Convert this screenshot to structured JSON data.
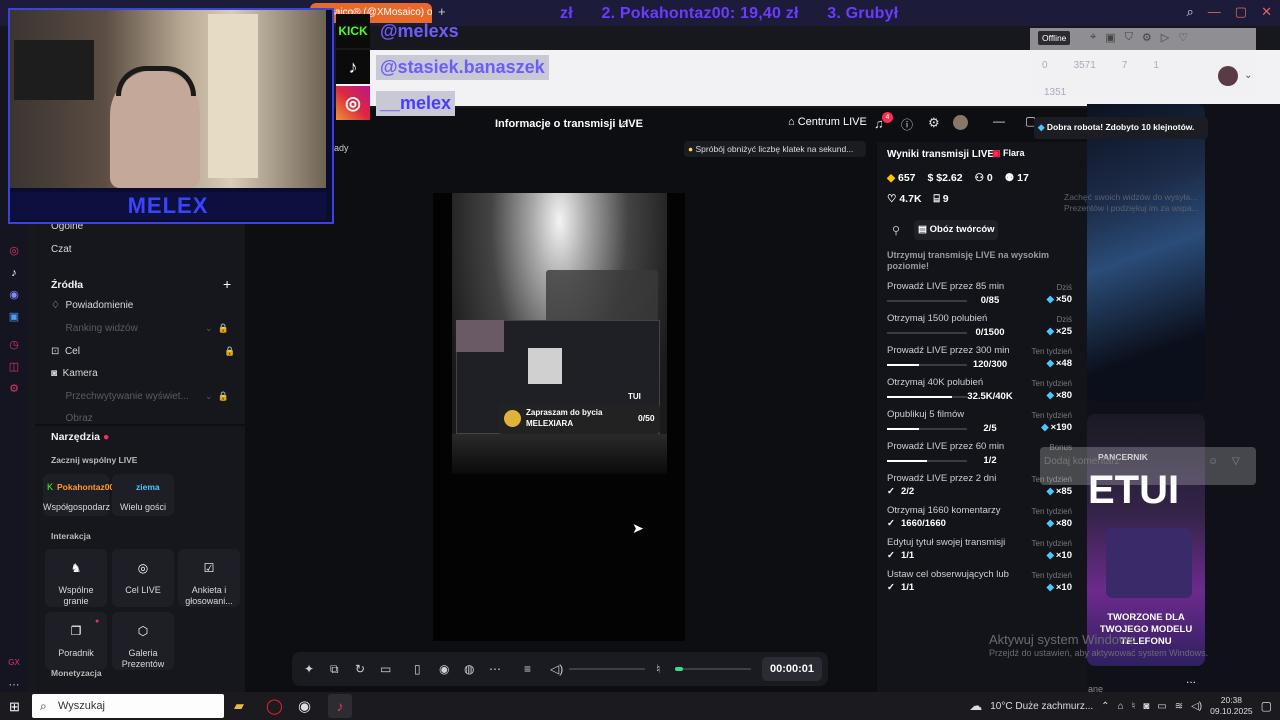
{
  "browser": {
    "active_tab": "Mosaico® (@XMosaico) o",
    "ticker": [
      "zł",
      "2. Pokahontaz00: 19,40 zł",
      "3. Grubył"
    ],
    "offline_badge": "Offline",
    "stats_faded": [
      "0",
      "3571",
      "7",
      "1"
    ],
    "stats_faded2": "1351"
  },
  "overlay": {
    "streamer_name": "MELEX",
    "kick_handle": "@melexs",
    "tiktok_handle": "@stasiek.banaszek",
    "instagram_handle": "__melex",
    "kick_label": "KICK"
  },
  "studio": {
    "title": "Informacje o transmisji LIVE",
    "center_button": "Centrum LIVE",
    "notification_count": "4",
    "hint": "Spróbój obniżyć liczbę klatek na sekund...",
    "left_fragment": "ady",
    "timer": "00:00:01",
    "sidebar": {
      "items_top": [
        "Ogólne",
        "Czat"
      ],
      "sources_heading": "Źródła",
      "sources": [
        {
          "label": "Powiadomienie",
          "dim": false
        },
        {
          "label": "Ranking widzów",
          "dim": true
        },
        {
          "label": "Cel",
          "dim": false
        },
        {
          "label": "Kamera",
          "dim": false
        },
        {
          "label": "Przechwytywanie wyświet...",
          "dim": true
        },
        {
          "label": "Obraz",
          "dim": true
        }
      ],
      "tools_heading": "Narzędzia",
      "start_joint": "Zacznij wspólny LIVE",
      "cohost_overlay_1": "Pokahontaz00",
      "cohost_overlay_2": "ziema",
      "cohost": [
        "Współgospodarz",
        "Wielu gości"
      ],
      "interaction_heading": "Interakcja",
      "interaction": [
        "Wspólne granie",
        "Cel LIVE",
        "Ankieta i głosowani...",
        "Poradnik",
        "Galeria Prezentów"
      ],
      "monetization_heading": "Monetyzacja"
    },
    "preview": {
      "card_text": "Zapraszam do bycia MELEXIARA",
      "card_count": "0/50",
      "overlay_text": "TUI"
    },
    "results": {
      "heading": "Wyniki transmisji LIVE",
      "badge": "Flara",
      "stats": [
        {
          "icon": "gem-icon",
          "value": "657"
        },
        {
          "icon": "dollar-icon",
          "value": "$2.62"
        },
        {
          "icon": "users-icon",
          "value": "0"
        },
        {
          "icon": "user-plus-icon",
          "value": "17"
        },
        {
          "icon": "heart-icon",
          "value": "4.7K"
        },
        {
          "icon": "gift-icon",
          "value": "9"
        }
      ],
      "camp_button": "Obóz twórców",
      "keep_heading": "Utrzymuj transmisję LIVE na wysokim poziomie!",
      "tasks": [
        {
          "label": "Prowadź LIVE przez 85 min",
          "progress": "0/85",
          "tag": "Dziś",
          "reward": "×50",
          "fill": 0
        },
        {
          "label": "Otrzymaj 1500 polubień",
          "progress": "0/1500",
          "tag": "Dziś",
          "reward": "×25",
          "fill": 0
        },
        {
          "label": "Prowadź LIVE przez 300 min",
          "progress": "120/300",
          "tag": "Ten tydzień",
          "reward": "×48",
          "fill": 0.4
        },
        {
          "label": "Otrzymaj 40K polubień",
          "progress": "32.5K/40K",
          "tag": "Ten tydzień",
          "reward": "×80",
          "fill": 0.81
        },
        {
          "label": "Opublikuj 5 filmów",
          "progress": "2/5",
          "tag": "Ten tydzień",
          "reward": "×190",
          "fill": 0.4
        },
        {
          "label": "Prowadź LIVE przez 60 min",
          "progress": "1/2",
          "tag": "Bonus",
          "reward": "",
          "fill": 0.5
        },
        {
          "label": "Prowadź LIVE przez 2 dni",
          "progress": "2/2",
          "tag": "Ten tydzień",
          "reward": "×85",
          "check": true
        },
        {
          "label": "Otrzymaj 1660 komentarzy",
          "progress": "1660/1660",
          "tag": "Ten tydzień",
          "reward": "×80",
          "check": true
        },
        {
          "label": "Edytuj tytuł swojej transmisji",
          "progress": "1/1",
          "tag": "Ten tydzień",
          "reward": "×10",
          "check": true
        },
        {
          "label": "Ustaw cel obserwujących lub",
          "progress": "1/1",
          "tag": "Ten tydzień",
          "reward": "×10",
          "check": true
        }
      ]
    }
  },
  "right_column": {
    "toast": "Dobra robota! Zdobyto 10 klejnotów.",
    "faded_text": "Zachęć swoich widzów do wysyła... Prezentów i podziękuj im za wspa...",
    "add_comment": "Dodaj komentarz",
    "product_brand": "PANCERNIK",
    "product_big": "ETUI",
    "product_caption": "TWORZONE DLA TWOJEGO MODELU TELEFONU",
    "more": "...",
    "last_line": "ane"
  },
  "windows": {
    "activate_title": "Aktywuj system Windows",
    "activate_sub": "Przejdź do ustawień, aby aktywować system Windows.",
    "search_placeholder": "Wyszukaj",
    "weather": "10°C  Duże zachmurz...",
    "time": "20:38",
    "date": "09.10.2025"
  },
  "colors": {
    "accent_blue": "#4bc6ff",
    "ticker_purple": "#6b3cff",
    "tiktok_red": "#fe2c55"
  }
}
